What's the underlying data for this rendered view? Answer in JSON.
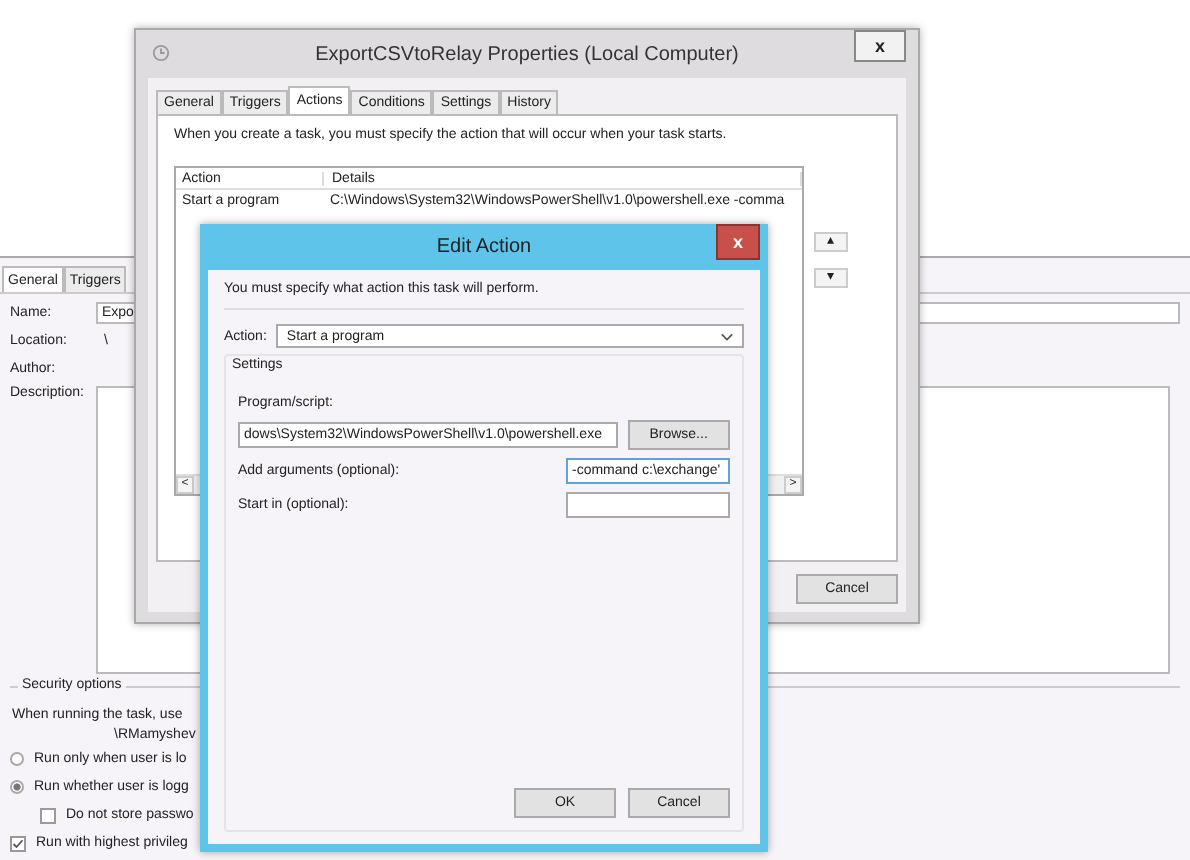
{
  "task_window": {
    "tabs": [
      {
        "label": "General",
        "selected": true
      },
      {
        "label": "Triggers",
        "selected": false
      }
    ],
    "fields": [
      {
        "kind": "text",
        "label": "Name:",
        "value": "Expo"
      },
      {
        "kind": "plain",
        "label": "Location:",
        "value": "\\"
      },
      {
        "kind": "plain",
        "label": "Author:"
      },
      {
        "kind": "area",
        "label": "Description:"
      }
    ],
    "security": {
      "title": "Security options",
      "text": "When running the task, use",
      "account": "\\RMamyshev",
      "options": [
        {
          "kind": "radio",
          "label": "Run only when user is lo",
          "checked": false,
          "indented": false
        },
        {
          "kind": "radio",
          "label": "Run whether user is logg",
          "checked": true,
          "indented": false
        },
        {
          "kind": "check",
          "label": "Do not store passwo",
          "checked": false,
          "indented": true
        },
        {
          "kind": "check",
          "label": "Run with highest privileg",
          "checked": true,
          "indented": false
        }
      ]
    }
  },
  "properties_window": {
    "title": "ExportCSVtoRelay Properties (Local Computer)",
    "close": "x",
    "tabs": [
      {
        "label": "General",
        "selected": false
      },
      {
        "label": "Triggers",
        "selected": false
      },
      {
        "label": "Actions",
        "selected": true
      },
      {
        "label": "Conditions",
        "selected": false
      },
      {
        "label": "Settings",
        "selected": false
      },
      {
        "label": "History",
        "selected": false
      }
    ],
    "intro": "When you create a task, you must specify the action that will occur when your task starts.",
    "table": {
      "columns": [
        "Action",
        "Details"
      ],
      "rows": [
        [
          "Start a program",
          "C:\\Windows\\System32\\WindowsPowerShell\\v1.0\\powershell.exe -comma"
        ]
      ]
    },
    "scroll_left": "<",
    "scroll_right": ">",
    "move_up": "▴",
    "move_down": "▾",
    "buttons": [
      "Cancel"
    ]
  },
  "edit_action": {
    "title": "Edit Action",
    "close": "x",
    "intro": "You must specify what action this task will perform.",
    "action_label": "Action:",
    "action_value": "Start a program",
    "settings_title": "Settings",
    "program_label": "Program/script:",
    "program_value": "dows\\System32\\WindowsPowerShell\\v1.0\\powershell.exe",
    "browse": "Browse...",
    "args_label": "Add arguments (optional):",
    "args_value": "-command c:\\exchange'",
    "start_label": "Start in (optional):",
    "buttons": [
      "OK",
      "Cancel"
    ]
  }
}
